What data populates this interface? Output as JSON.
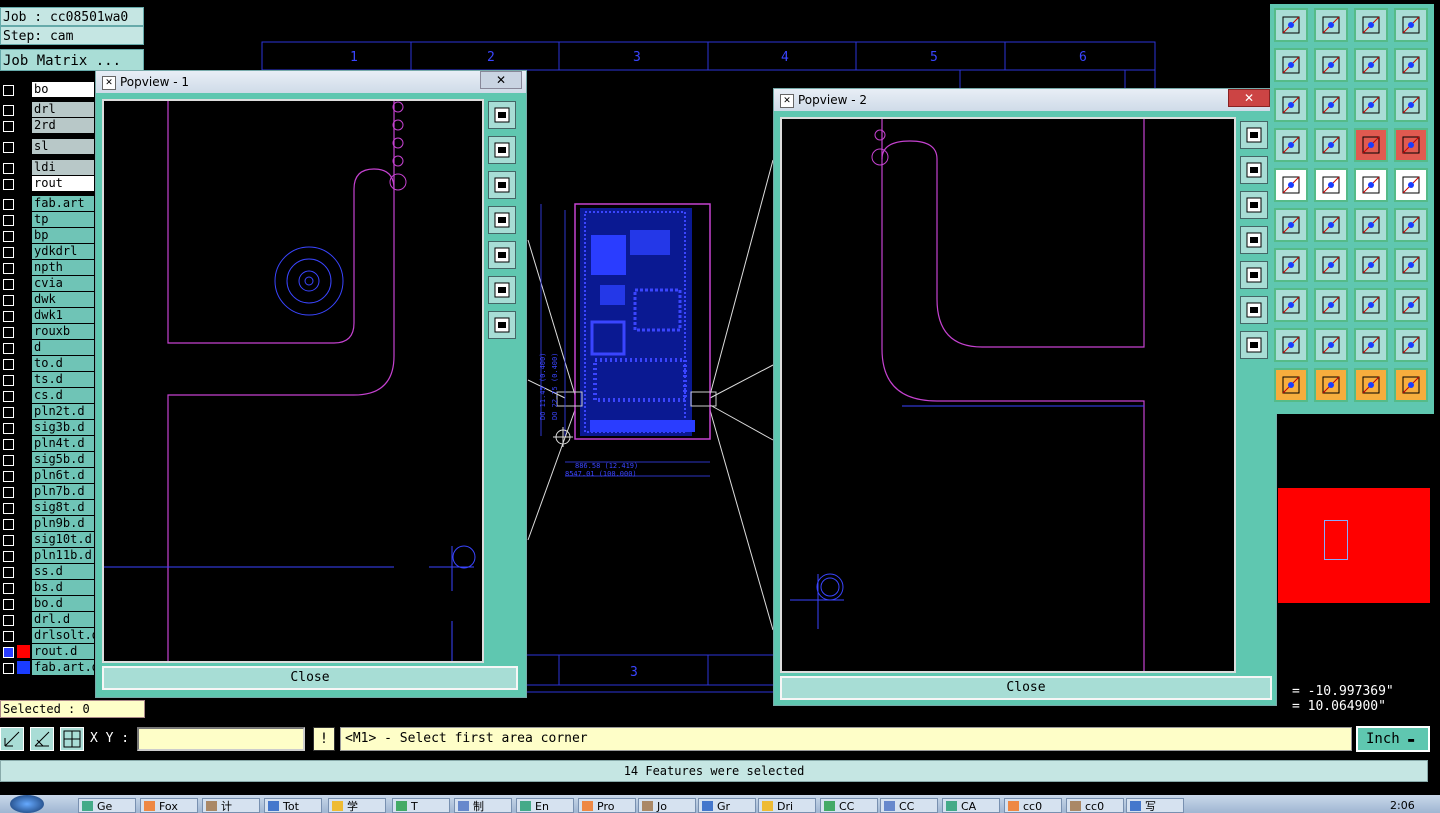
{
  "job": {
    "label": "Job : cc08501wa0",
    "step": "Step: cam",
    "matrix_button": "Job Matrix ..."
  },
  "layers": [
    {
      "name": "bo",
      "highlight": "white"
    },
    {
      "name": "drl",
      "highlight": "gray"
    },
    {
      "name": "2rd",
      "highlight": "gray"
    },
    {
      "name": "sl",
      "highlight": "gray"
    },
    {
      "name": "ldi",
      "highlight": "gray"
    },
    {
      "name": "rout",
      "highlight": "white"
    },
    {
      "name": "fab.art"
    },
    {
      "name": "tp"
    },
    {
      "name": "bp"
    },
    {
      "name": "ydkdrl"
    },
    {
      "name": "npth"
    },
    {
      "name": "cvia"
    },
    {
      "name": "dwk"
    },
    {
      "name": "dwk1"
    },
    {
      "name": "rouxb"
    },
    {
      "name": "d"
    },
    {
      "name": "to.d"
    },
    {
      "name": "ts.d"
    },
    {
      "name": "cs.d"
    },
    {
      "name": "pln2t.d"
    },
    {
      "name": "sig3b.d"
    },
    {
      "name": "pln4t.d"
    },
    {
      "name": "sig5b.d"
    },
    {
      "name": "pln6t.d"
    },
    {
      "name": "pln7b.d"
    },
    {
      "name": "sig8t.d"
    },
    {
      "name": "pln9b.d"
    },
    {
      "name": "sig10t.d"
    },
    {
      "name": "pln11b.d"
    },
    {
      "name": "ss.d"
    },
    {
      "name": "bs.d"
    },
    {
      "name": "bo.d"
    },
    {
      "name": "drl.d"
    },
    {
      "name": "drlsolt.d"
    },
    {
      "name": "rout.d",
      "color": "#ff0000",
      "checked": true
    },
    {
      "name": "fab.art.d",
      "color": "#1a3cff"
    }
  ],
  "selected": "Selected : 0",
  "grid_labels_top": [
    "1",
    "2",
    "3",
    "4",
    "5",
    "6"
  ],
  "grid_label_bottom": "3",
  "popview1": {
    "title": "Popview - 1",
    "close_label": "Close"
  },
  "popview2": {
    "title": "Popview - 2",
    "close_label": "Close"
  },
  "dimension_texts": [
    "886.58 (12.419)",
    "8547.01 (100.000)",
    "DO 11.45 (0.400)",
    "DO 22.75 (0.400)"
  ],
  "coords": {
    "x": " = -10.997369\"",
    "y": " = 10.064900\""
  },
  "command": {
    "xy_label": "X Y :",
    "xy_value": "",
    "prompt": "<M1> - Select first area corner",
    "units": "Inch"
  },
  "status": "14 Features were selected",
  "taskbar": {
    "items": [
      "Ge",
      "Fox",
      "计",
      "Tot",
      "学",
      "T",
      "制",
      "En",
      "Pro",
      "Jo",
      "Gr",
      "Dri",
      "CC",
      "CC",
      "CA",
      "cc0",
      "cc0",
      "写"
    ],
    "clock": "2:06"
  },
  "colors": {
    "panel_teal": "#5fc7b0",
    "light_teal": "#c5e6e3",
    "yellow": "#fefec8",
    "rout": "#c542d0",
    "board": "#2a3dff"
  }
}
